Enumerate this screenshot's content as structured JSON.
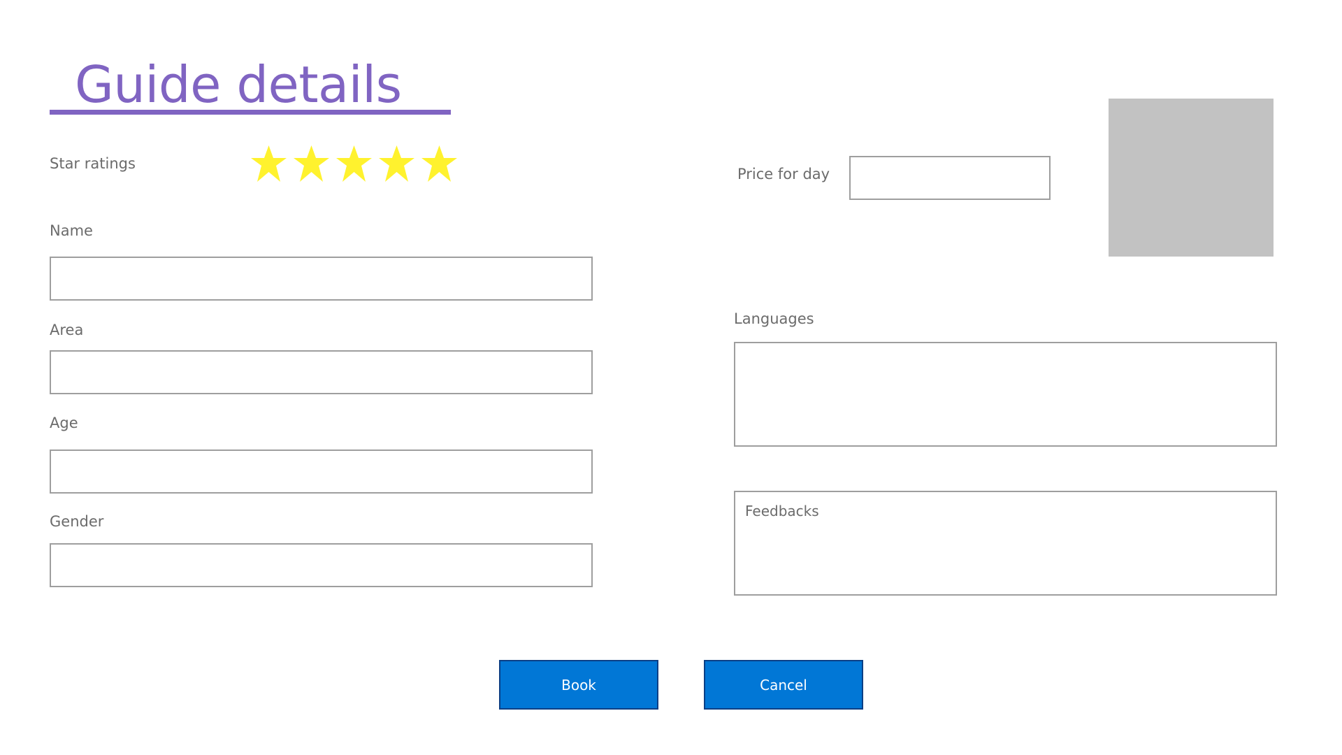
{
  "page": {
    "title": "Guide details"
  },
  "colors": {
    "title": "#8064c2",
    "star": "#fff22e",
    "button": "#0177d6",
    "button_border": "#0b3f85",
    "photo_placeholder": "#c2c2c2",
    "field_border": "#9e9e9e"
  },
  "rating": {
    "label": "Star ratings",
    "value": 5,
    "max": 5,
    "icon": "star-icon"
  },
  "price": {
    "label": "Price for day",
    "value": ""
  },
  "photo": {
    "icon": "guide-photo-placeholder"
  },
  "fields": {
    "name": {
      "label": "Name",
      "value": ""
    },
    "area": {
      "label": "Area",
      "value": ""
    },
    "age": {
      "label": "Age",
      "value": ""
    },
    "gender": {
      "label": "Gender",
      "value": ""
    },
    "languages": {
      "label": "Languages",
      "value": ""
    },
    "feedbacks": {
      "placeholder": "Feedbacks",
      "value": ""
    }
  },
  "buttons": {
    "book": "Book",
    "cancel": "Cancel"
  }
}
